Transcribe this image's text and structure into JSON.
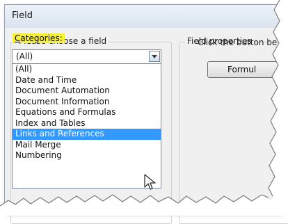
{
  "dialog": {
    "title": "Field"
  },
  "left_group": {
    "legend": "Please choose a field",
    "categories_label": "ategories:",
    "categories_accel": "C",
    "combo_value": "(All)",
    "items": [
      "(All)",
      "Date and Time",
      "Document Automation",
      "Document Information",
      "Equations and Formulas",
      "Index and Tables",
      "Links and References",
      "Mail Merge",
      "Numbering"
    ],
    "selected_index": 6
  },
  "right_group": {
    "legend": "Field properties",
    "prompt": "Click the button be",
    "formula_button": "Formul"
  },
  "colors": {
    "selection": "#3399ff",
    "highlight": "#f5ef3a"
  }
}
